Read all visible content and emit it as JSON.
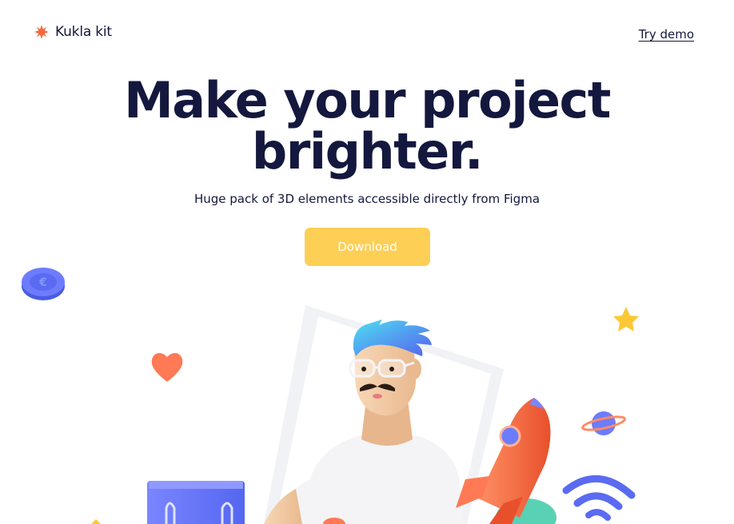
{
  "brand": {
    "name": "Kukla kit",
    "logo_icon": "sun-burst-icon",
    "accent": "#f26a3d"
  },
  "nav": {
    "try_demo": "Try demo"
  },
  "hero": {
    "title_line1": "Make your project",
    "title_line2": "brighter.",
    "subtitle": "Huge pack of 3D elements accessible directly from Figma",
    "cta": "Download",
    "cta_color": "#fdcf55"
  },
  "illustration": {
    "elements": [
      "coin-icon",
      "heart-icon",
      "star-icon",
      "planet-icon",
      "rocket-icon",
      "wifi-icon",
      "shopping-bag-icon",
      "character-with-glasses"
    ]
  }
}
